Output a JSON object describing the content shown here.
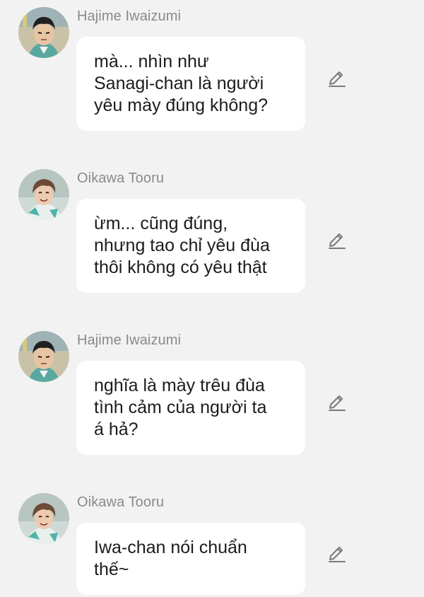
{
  "messages": [
    {
      "sender": "Hajime Iwaizumi",
      "avatar": "iwaizumi-avatar",
      "text": "mà... nhìn như\nSanagi-chan là người\nyêu mày đúng không?",
      "action_icon": "pencil-icon"
    },
    {
      "sender": "Oikawa Tooru",
      "avatar": "oikawa-avatar",
      "text": "ừm... cũng đúng,\nnhưng tao chỉ yêu đùa\nthôi không có yêu thật",
      "action_icon": "pencil-icon"
    },
    {
      "sender": "Hajime Iwaizumi",
      "avatar": "iwaizumi-avatar",
      "text": "nghĩa là mày trêu đùa\ntình cảm của người ta\ná hả?",
      "action_icon": "pencil-icon"
    },
    {
      "sender": "Oikawa Tooru",
      "avatar": "oikawa-avatar",
      "text": "Iwa-chan nói chuẩn\nthế~",
      "action_icon": "pencil-icon"
    }
  ],
  "colors": {
    "background": "#f2f2f2",
    "bubble": "#ffffff",
    "sender_name": "#8a8a8a",
    "message_text": "#1c1c1c",
    "icon": "#7a7a7a"
  }
}
